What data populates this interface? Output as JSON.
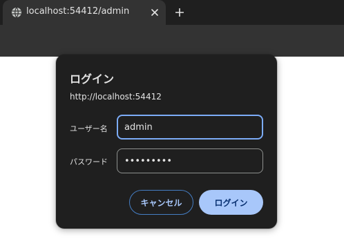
{
  "browser": {
    "tab": {
      "title": "localhost:54412/admin",
      "favicon_icon": "globe-icon",
      "close_icon": "close-icon"
    },
    "new_tab_icon": "plus-icon"
  },
  "dialog": {
    "title": "ログイン",
    "origin": "http://localhost:54412",
    "username": {
      "label": "ユーザー名",
      "value": "admin"
    },
    "password": {
      "label": "パスワード",
      "value": "•••••••••"
    },
    "cancel_label": "キャンセル",
    "login_label": "ログイン"
  },
  "colors": {
    "tabstrip_bg": "#1f1f1f",
    "toolbar_bg": "#333333",
    "dialog_bg": "#1f1f1f",
    "focus_ring": "#7cacf8",
    "primary_button": "#a8c7fa",
    "primary_button_text": "#062e6f"
  }
}
